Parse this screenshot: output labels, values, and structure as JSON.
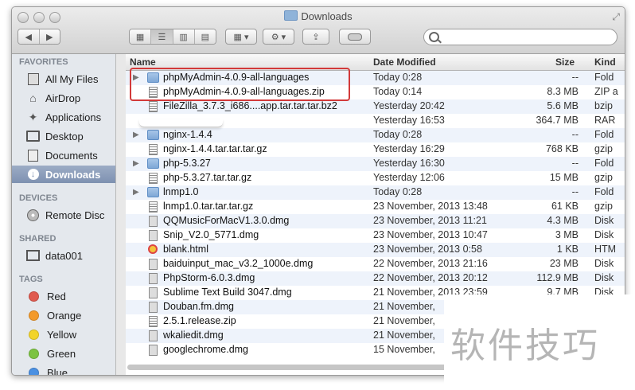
{
  "window": {
    "title": "Downloads"
  },
  "sidebar": {
    "sections": [
      {
        "heading": "FAVORITES",
        "items": [
          {
            "label": "All My Files",
            "icon": "all-files-icon"
          },
          {
            "label": "AirDrop",
            "icon": "airdrop-icon"
          },
          {
            "label": "Applications",
            "icon": "applications-icon"
          },
          {
            "label": "Desktop",
            "icon": "desktop-icon"
          },
          {
            "label": "Documents",
            "icon": "documents-icon"
          },
          {
            "label": "Downloads",
            "icon": "downloads-icon",
            "selected": true
          }
        ]
      },
      {
        "heading": "DEVICES",
        "items": [
          {
            "label": "Remote Disc",
            "icon": "disc-icon"
          }
        ]
      },
      {
        "heading": "SHARED",
        "items": [
          {
            "label": "data001",
            "icon": "monitor-icon"
          }
        ]
      },
      {
        "heading": "TAGS",
        "items": [
          {
            "label": "Red",
            "color": "#e05a4f"
          },
          {
            "label": "Orange",
            "color": "#f39a2b"
          },
          {
            "label": "Yellow",
            "color": "#f2d42a"
          },
          {
            "label": "Green",
            "color": "#7cc341"
          },
          {
            "label": "Blue",
            "color": "#4a90e2"
          }
        ]
      }
    ]
  },
  "columns": {
    "name": "Name",
    "date": "Date Modified",
    "size": "Size",
    "kind": "Kind"
  },
  "files": [
    {
      "name": "phpMyAdmin-4.0.9-all-languages",
      "date": "Today 0:28",
      "size": "--",
      "kind": "Fold",
      "type": "folder",
      "disclosure": true
    },
    {
      "name": "phpMyAdmin-4.0.9-all-languages.zip",
      "date": "Today 0:14",
      "size": "8.3 MB",
      "kind": "ZIP a",
      "type": "zip"
    },
    {
      "name": "FileZilla_3.7.3_i686....app.tar.tar.tar.bz2",
      "date": "Yesterday 20:42",
      "size": "5.6 MB",
      "kind": "bzip",
      "type": "zip"
    },
    {
      "name": "",
      "date": "Yesterday 16:53",
      "size": "364.7 MB",
      "kind": "RAR",
      "type": "none"
    },
    {
      "name": "nginx-1.4.4",
      "date": "Today 0:28",
      "size": "--",
      "kind": "Fold",
      "type": "folder",
      "disclosure": true
    },
    {
      "name": "nginx-1.4.4.tar.tar.tar.gz",
      "date": "Yesterday 16:29",
      "size": "768 KB",
      "kind": "gzip",
      "type": "zip"
    },
    {
      "name": "php-5.3.27",
      "date": "Yesterday 16:30",
      "size": "--",
      "kind": "Fold",
      "type": "folder",
      "disclosure": true
    },
    {
      "name": "php-5.3.27.tar.tar.gz",
      "date": "Yesterday 12:06",
      "size": "15 MB",
      "kind": "gzip",
      "type": "zip"
    },
    {
      "name": "lnmp1.0",
      "date": "Today 0:28",
      "size": "--",
      "kind": "Fold",
      "type": "folder",
      "disclosure": true
    },
    {
      "name": "lnmp1.0.tar.tar.tar.gz",
      "date": "23 November, 2013 13:48",
      "size": "61 KB",
      "kind": "gzip",
      "type": "zip"
    },
    {
      "name": "QQMusicForMacV1.3.0.dmg",
      "date": "23 November, 2013 11:21",
      "size": "4.3 MB",
      "kind": "Disk",
      "type": "dmg"
    },
    {
      "name": "Snip_V2.0_5771.dmg",
      "date": "23 November, 2013 10:47",
      "size": "3 MB",
      "kind": "Disk",
      "type": "dmg"
    },
    {
      "name": "blank.html",
      "date": "23 November, 2013 0:58",
      "size": "1 KB",
      "kind": "HTM",
      "type": "html"
    },
    {
      "name": "baiduinput_mac_v3.2_1000e.dmg",
      "date": "22 November, 2013 21:16",
      "size": "23 MB",
      "kind": "Disk",
      "type": "dmg"
    },
    {
      "name": "PhpStorm-6.0.3.dmg",
      "date": "22 November, 2013 20:12",
      "size": "112.9 MB",
      "kind": "Disk",
      "type": "dmg"
    },
    {
      "name": "Sublime Text Build 3047.dmg",
      "date": "21 November, 2013 23:59",
      "size": "9.7 MB",
      "kind": "Disk",
      "type": "dmg"
    },
    {
      "name": "Douban.fm.dmg",
      "date": "21 November,",
      "size": "",
      "kind": "",
      "type": "dmg"
    },
    {
      "name": "2.5.1.release.zip",
      "date": "21 November,",
      "size": "",
      "kind": "",
      "type": "zip"
    },
    {
      "name": "wkaliedit.dmg",
      "date": "21 November,",
      "size": "",
      "kind": "",
      "type": "dmg"
    },
    {
      "name": "googlechrome.dmg",
      "date": "15 November,",
      "size": "",
      "kind": "",
      "type": "dmg"
    }
  ],
  "watermark": "软件技巧"
}
